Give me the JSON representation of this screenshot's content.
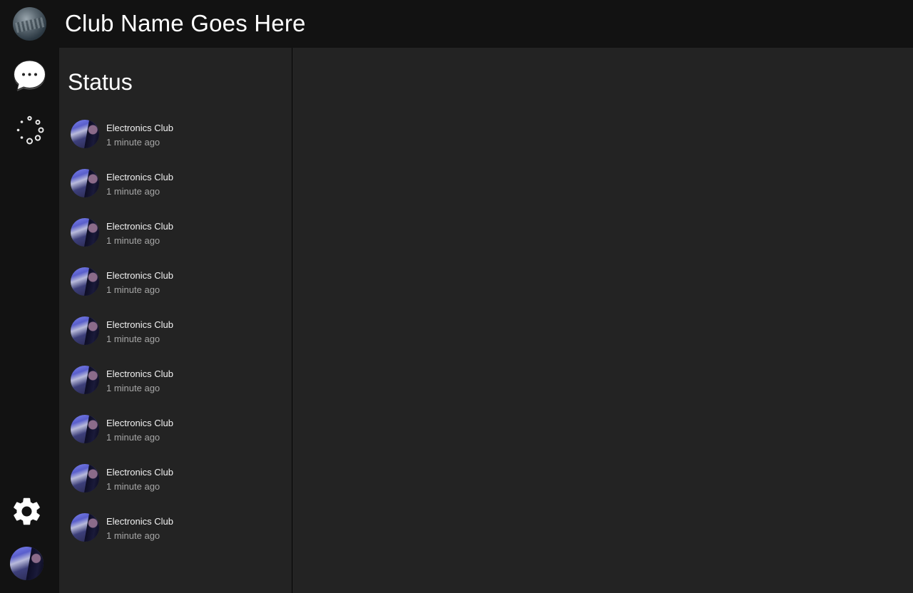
{
  "header": {
    "club_title": "Club Name Goes Here"
  },
  "rail": {
    "icons": [
      "club-avatar",
      "chat-bubble-icon",
      "status-dots-icon",
      "gear-icon",
      "profile-avatar"
    ]
  },
  "status_panel": {
    "heading": "Status",
    "items": [
      {
        "name": "Electronics Club",
        "time": "1 minute ago"
      },
      {
        "name": "Electronics Club",
        "time": "1 minute ago"
      },
      {
        "name": "Electronics Club",
        "time": "1 minute ago"
      },
      {
        "name": "Electronics Club",
        "time": "1 minute ago"
      },
      {
        "name": "Electronics Club",
        "time": "1 minute ago"
      },
      {
        "name": "Electronics Club",
        "time": "1 minute ago"
      },
      {
        "name": "Electronics Club",
        "time": "1 minute ago"
      },
      {
        "name": "Electronics Club",
        "time": "1 minute ago"
      },
      {
        "name": "Electronics Club",
        "time": "1 minute ago"
      }
    ]
  },
  "colors": {
    "topbar_bg": "#121212",
    "rail_bg": "#121212",
    "panel_bg": "#232323",
    "main_bg": "#232323",
    "text_primary": "#ffffff",
    "text_secondary": "#a6a6a6"
  }
}
